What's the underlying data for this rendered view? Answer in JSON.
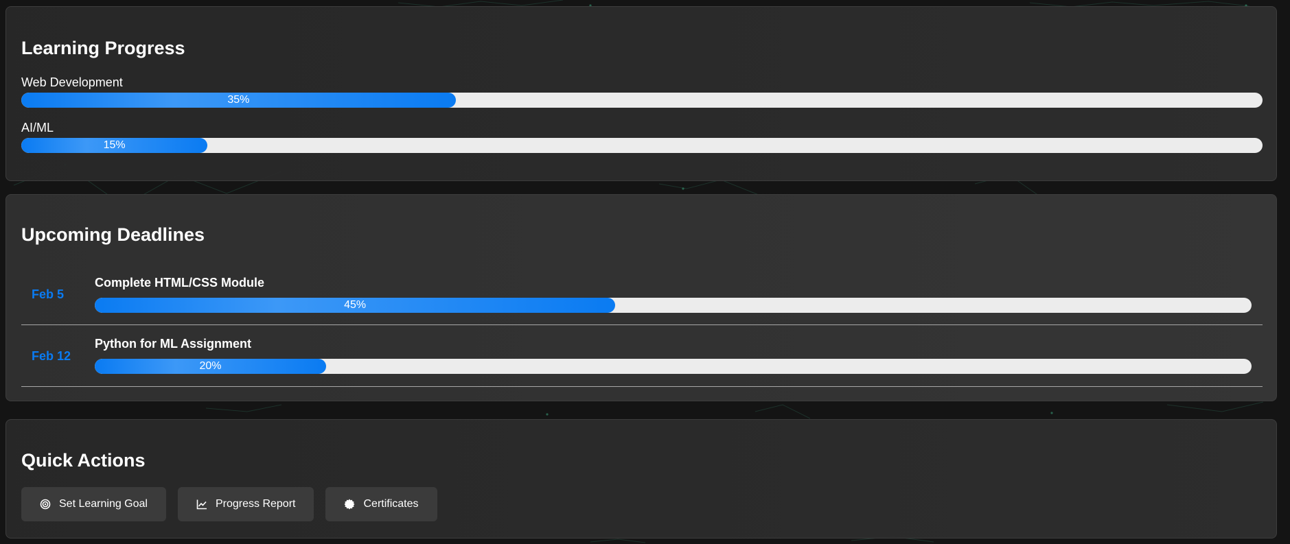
{
  "learning_progress": {
    "title": "Learning Progress",
    "courses": [
      {
        "label": "Web Development",
        "progress": 35,
        "progress_text": "35%"
      },
      {
        "label": "AI/ML",
        "progress": 15,
        "progress_text": "15%"
      }
    ]
  },
  "deadlines": {
    "title": "Upcoming Deadlines",
    "items": [
      {
        "date": "Feb 5",
        "title": "Complete HTML/CSS Module",
        "progress": 45,
        "progress_text": "45%"
      },
      {
        "date": "Feb 12",
        "title": "Python for ML Assignment",
        "progress": 20,
        "progress_text": "20%"
      }
    ]
  },
  "quick_actions": {
    "title": "Quick Actions",
    "buttons": [
      {
        "label": "Set Learning Goal",
        "icon": "target-icon"
      },
      {
        "label": "Progress Report",
        "icon": "line-chart-icon"
      },
      {
        "label": "Certificates",
        "icon": "certificate-icon"
      }
    ]
  },
  "colors": {
    "accent": "#0a7bf2",
    "bar_track": "#ececec",
    "background": "#141414"
  }
}
